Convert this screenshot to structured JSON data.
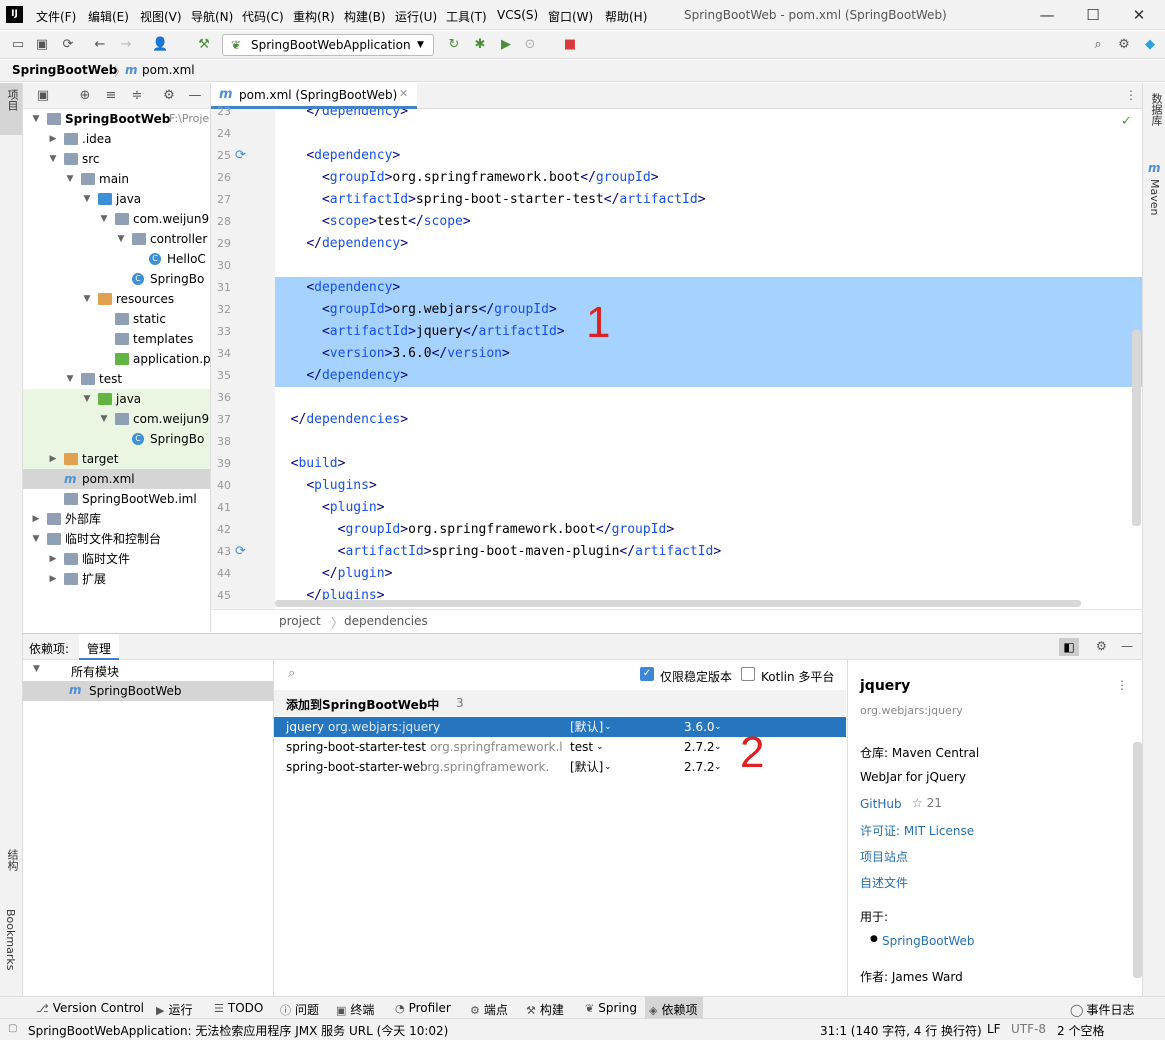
{
  "window": {
    "title": "SpringBootWeb - pom.xml (SpringBootWeb)",
    "logo": "IJ"
  },
  "menu": [
    "文件(F)",
    "编辑(E)",
    "视图(V)",
    "导航(N)",
    "代码(C)",
    "重构(R)",
    "构建(B)",
    "运行(U)",
    "工具(T)",
    "VCS(S)",
    "窗口(W)",
    "帮助(H)"
  ],
  "toolbar": {
    "run_config": "SpringBootWebApplication"
  },
  "breadcrumb": {
    "project": "SpringBootWeb",
    "file": "pom.xml"
  },
  "left_strip": {
    "project": "项目",
    "structure": "结构",
    "bookmarks": "Bookmarks"
  },
  "right_strip": {
    "database": "数据库",
    "maven": "Maven"
  },
  "project_tree": [
    {
      "label": "SpringBootWeb",
      "suffix": "F:\\Proje",
      "depth": 0,
      "arrow": "open",
      "icon": "fold",
      "bold": true
    },
    {
      "label": ".idea",
      "depth": 1,
      "arrow": "closed",
      "icon": "fold"
    },
    {
      "label": "src",
      "depth": 1,
      "arrow": "open",
      "icon": "fold"
    },
    {
      "label": "main",
      "depth": 2,
      "arrow": "open",
      "icon": "fold"
    },
    {
      "label": "java",
      "depth": 3,
      "arrow": "open",
      "icon": "foldb"
    },
    {
      "label": "com.weijun9",
      "depth": 4,
      "arrow": "open",
      "icon": "fold"
    },
    {
      "label": "controller",
      "depth": 5,
      "arrow": "open",
      "icon": "fold"
    },
    {
      "label": "HelloC",
      "depth": 6,
      "arrow": "",
      "icon": "cls"
    },
    {
      "label": "SpringBo",
      "depth": 5,
      "arrow": "",
      "icon": "cls"
    },
    {
      "label": "resources",
      "depth": 3,
      "arrow": "open",
      "icon": "foldo"
    },
    {
      "label": "static",
      "depth": 4,
      "arrow": "",
      "icon": "fold"
    },
    {
      "label": "templates",
      "depth": 4,
      "arrow": "",
      "icon": "fold"
    },
    {
      "label": "application.p",
      "depth": 4,
      "arrow": "",
      "icon": "foldg"
    },
    {
      "label": "test",
      "depth": 2,
      "arrow": "open",
      "icon": "fold"
    },
    {
      "label": "java",
      "depth": 3,
      "arrow": "open",
      "icon": "foldg",
      "hl": true
    },
    {
      "label": "com.weijun9",
      "depth": 4,
      "arrow": "open",
      "icon": "fold",
      "hl": true
    },
    {
      "label": "SpringBo",
      "depth": 5,
      "arrow": "",
      "icon": "cls",
      "hl": true
    },
    {
      "label": "target",
      "depth": 1,
      "arrow": "closed",
      "icon": "foldo",
      "hl": true
    },
    {
      "label": "pom.xml",
      "depth": 1,
      "arrow": "",
      "icon": "m",
      "selected": true
    },
    {
      "label": "SpringBootWeb.iml",
      "depth": 1,
      "arrow": "",
      "icon": "fold"
    },
    {
      "label": "外部库",
      "depth": 0,
      "arrow": "closed",
      "icon": "fold"
    },
    {
      "label": "临时文件和控制台",
      "depth": 0,
      "arrow": "open",
      "icon": "fold"
    },
    {
      "label": "临时文件",
      "depth": 1,
      "arrow": "closed",
      "icon": "fold"
    },
    {
      "label": "扩展",
      "depth": 1,
      "arrow": "closed",
      "icon": "fold"
    }
  ],
  "editor_tab": "pom.xml (SpringBootWeb)",
  "code_lines": [
    {
      "n": "23",
      "indent": 2,
      "t": "close",
      "tag": "dependency"
    },
    {
      "n": "24",
      "indent": 0,
      "t": "blank"
    },
    {
      "n": "25",
      "indent": 2,
      "t": "open",
      "tag": "dependency"
    },
    {
      "n": "26",
      "indent": 3,
      "t": "el",
      "tag": "groupId",
      "text": "org.springframework.boot"
    },
    {
      "n": "27",
      "indent": 3,
      "t": "el",
      "tag": "artifactId",
      "text": "spring-boot-starter-test"
    },
    {
      "n": "28",
      "indent": 3,
      "t": "el",
      "tag": "scope",
      "text": "test"
    },
    {
      "n": "29",
      "indent": 2,
      "t": "close",
      "tag": "dependency"
    },
    {
      "n": "30",
      "indent": 0,
      "t": "blank"
    },
    {
      "n": "31",
      "indent": 2,
      "t": "open",
      "tag": "dependency",
      "sel": true
    },
    {
      "n": "32",
      "indent": 3,
      "t": "el",
      "tag": "groupId",
      "text": "org.webjars",
      "sel": true
    },
    {
      "n": "33",
      "indent": 3,
      "t": "el",
      "tag": "artifactId",
      "text": "jquery",
      "sel": true
    },
    {
      "n": "34",
      "indent": 3,
      "t": "el",
      "tag": "version",
      "text": "3.6.0",
      "sel": true
    },
    {
      "n": "35",
      "indent": 2,
      "t": "close",
      "tag": "dependency",
      "sel": true
    },
    {
      "n": "36",
      "indent": 0,
      "t": "blank"
    },
    {
      "n": "37",
      "indent": 1,
      "t": "close",
      "tag": "dependencies"
    },
    {
      "n": "38",
      "indent": 0,
      "t": "blank"
    },
    {
      "n": "39",
      "indent": 1,
      "t": "open",
      "tag": "build"
    },
    {
      "n": "40",
      "indent": 2,
      "t": "open",
      "tag": "plugins"
    },
    {
      "n": "41",
      "indent": 3,
      "t": "open",
      "tag": "plugin"
    },
    {
      "n": "42",
      "indent": 4,
      "t": "el",
      "tag": "groupId",
      "text": "org.springframework.boot"
    },
    {
      "n": "43",
      "indent": 4,
      "t": "el",
      "tag": "artifactId",
      "text": "spring-boot-maven-plugin"
    },
    {
      "n": "44",
      "indent": 3,
      "t": "close",
      "tag": "plugin"
    },
    {
      "n": "45",
      "indent": 2,
      "t": "close",
      "tag": "plugins"
    }
  ],
  "editor_breadcrumb": [
    "project",
    "dependencies"
  ],
  "annotation_1": "1",
  "annotation_2": "2",
  "deps_panel": {
    "tab_deps": "依赖项:",
    "tab_manage": "管理",
    "all_modules": "所有模块",
    "module": "SpringBootWeb",
    "stable_only": "仅限稳定版本",
    "kotlin": "Kotlin 多平台",
    "add_to": "添加到SpringBootWeb中",
    "count": "3",
    "rows": [
      {
        "name": "jquery",
        "group": "org.webjars:jquery",
        "scope": "[默认]",
        "version": "3.6.0",
        "selected": true
      },
      {
        "name": "spring-boot-starter-test",
        "group": "org.springframework.l",
        "scope": "test",
        "version": "2.7.2"
      },
      {
        "name": "spring-boot-starter-web",
        "group": "org.springframework.",
        "scope": "[默认]",
        "version": "2.7.2"
      }
    ]
  },
  "detail": {
    "title": "jquery",
    "coords": "org.webjars:jquery",
    "repo": "仓库: Maven Central",
    "desc": "WebJar for jQuery",
    "github": "GitHub",
    "stars": "☆ 21",
    "license": "许可证: MIT License",
    "site": "项目站点",
    "readme": "自述文件",
    "used_in": "用于:",
    "used_module": "SpringBootWeb",
    "author": "作者: James Ward"
  },
  "bottom_tools": [
    "Version Control",
    "运行",
    "TODO",
    "问题",
    "终端",
    "Profiler",
    "端点",
    "构建",
    "Spring",
    "依赖项"
  ],
  "event_log": "事件日志",
  "status": {
    "message": "SpringBootWebApplication: 无法检索应用程序 JMX 服务 URL (今天 10:02)",
    "position": "31:1 (140 字符, 4 行 换行符)",
    "eol": "LF",
    "encoding": "UTF-8",
    "indent": "2 个空格"
  },
  "colors": {
    "selection": "#a6d2ff",
    "accent": "#4083c9",
    "tag": "#000080",
    "tag_name": "#1750eb",
    "annotation": "#e02020"
  }
}
